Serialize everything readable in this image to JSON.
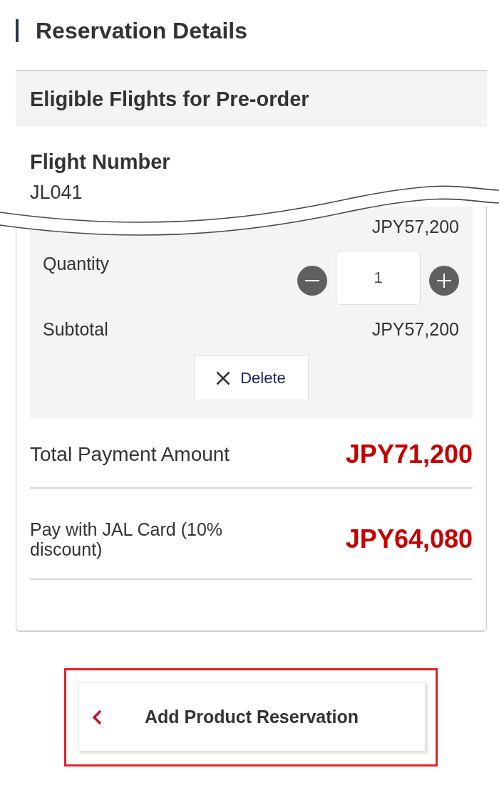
{
  "section_title": "Reservation Details",
  "flights_panel": {
    "header": "Eligible Flights for Pre-order",
    "flight_number_label": "Flight Number",
    "flight_number": "JL041"
  },
  "cart_item": {
    "price": "JPY57,200",
    "quantity_label": "Quantity",
    "quantity": "1",
    "subtotal_label": "Subtotal",
    "subtotal": "JPY57,200",
    "delete_label": "Delete"
  },
  "totals": [
    {
      "kind": "total",
      "label": "Total Payment Amount",
      "amount": "JPY71,200"
    },
    {
      "kind": "discount",
      "label": "Pay with JAL Card (10% discount)",
      "amount": "JPY64,080"
    }
  ],
  "back_button": {
    "label": "Add Product Reservation",
    "highlighted": true
  }
}
